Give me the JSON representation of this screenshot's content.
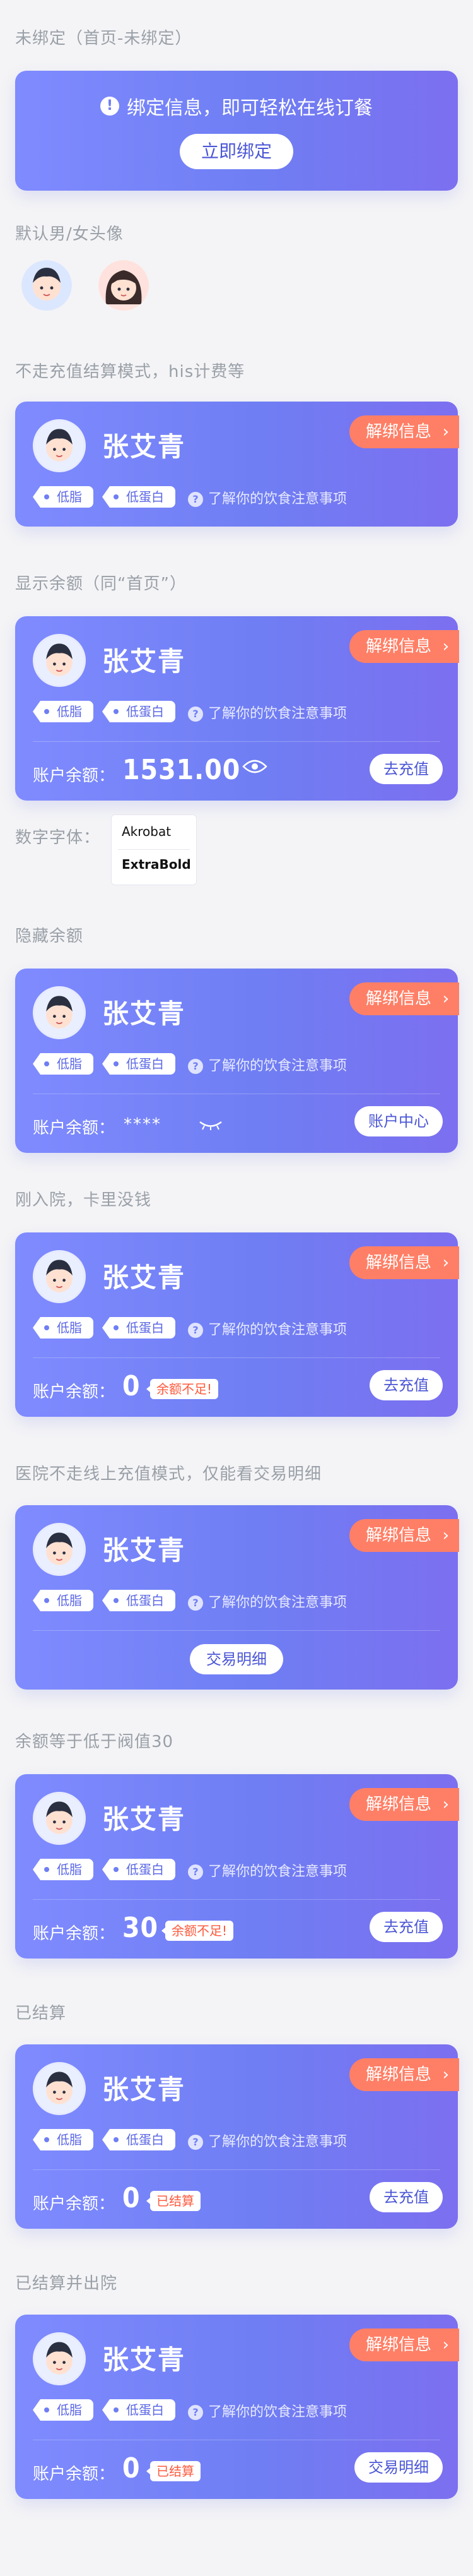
{
  "sections": {
    "unbound": "未绑定（首页-未绑定）",
    "default_avatar": "默认男/女头像",
    "no_recharge": "不走充值结算模式，his计费等",
    "show_balance": "显示余额（同“首页”）",
    "number_font": "数字字体：",
    "hide_balance": "隐藏余额",
    "just_admitted": "刚入院，卡里没钱",
    "hospital_no_online": "医院不走线上充值模式，仅能看交易明细",
    "threshold": "余额等于低于阀值30",
    "settled": "已结算",
    "settled_discharged": "已结算并出院"
  },
  "bind_card": {
    "alert_icon": "exclamation-circle-icon",
    "message": "绑定信息，即可轻松在线订餐",
    "button": "立即绑定"
  },
  "patient": {
    "name": "张艾青",
    "tags": [
      "低脂",
      "低蛋白"
    ],
    "diet_tip": "了解你的饮食注意事项",
    "unbind_label": "解绑信息"
  },
  "labels": {
    "balance_label": "账户余额：",
    "recharge": "去充值",
    "account_center": "账户中心",
    "transactions": "交易明细",
    "hidden_mask": "****"
  },
  "balances": {
    "show": "1531.00",
    "just_admitted": "0",
    "threshold": "30",
    "settled": "0",
    "settled_discharged": "0"
  },
  "warnings": {
    "insufficient": "余额不足!",
    "settled": "已结算"
  },
  "font_specimen": {
    "line1": "Akrobat",
    "line2": "ExtraBold"
  },
  "colors": {
    "card_gradient_start": "#7f8bff",
    "card_gradient_end": "#7c6ff0",
    "unbind_orange": "#ff7f66",
    "warn_red": "#ff5a3d"
  }
}
